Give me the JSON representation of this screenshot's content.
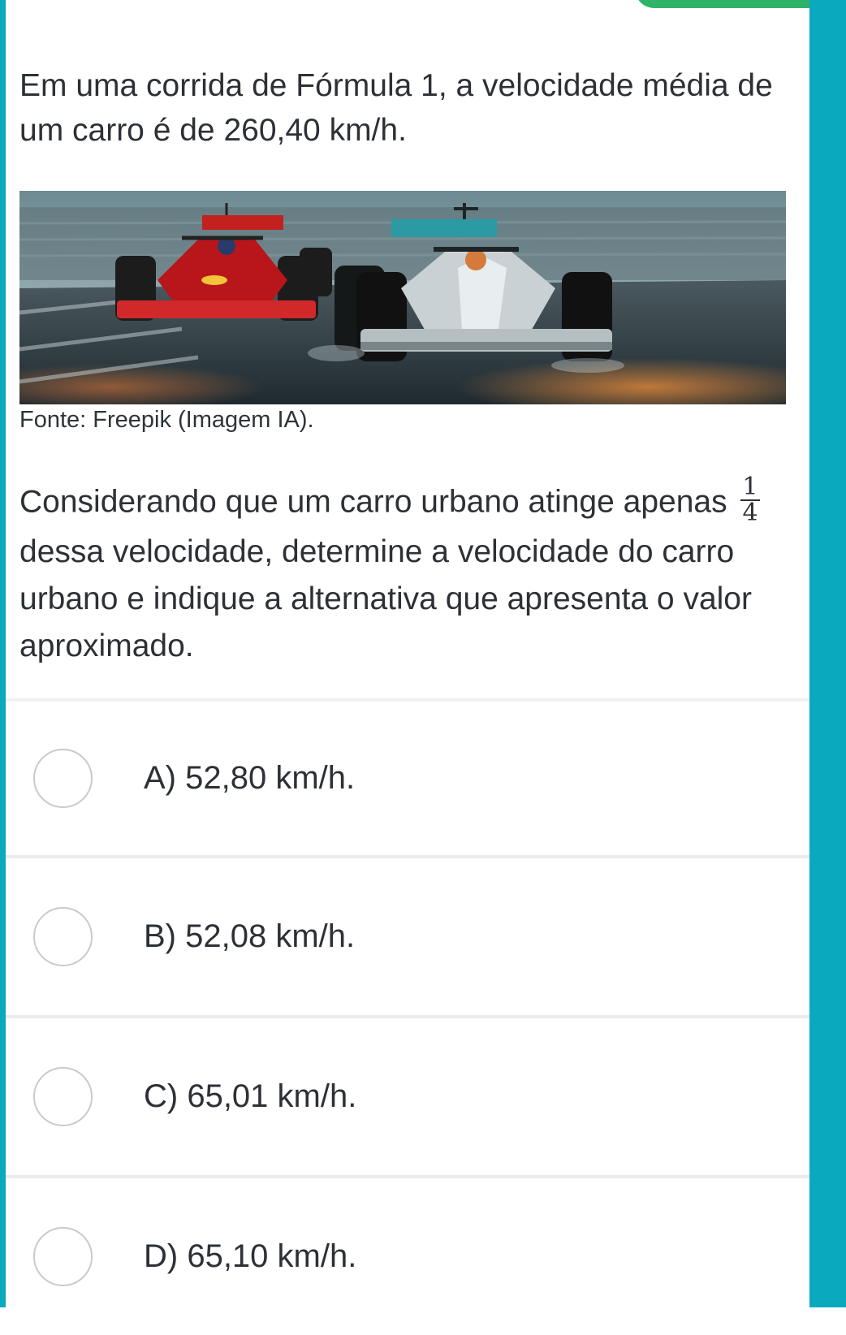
{
  "question": {
    "intro": "Em uma corrida de Fórmula 1, a velocidade média de um carro é de 260,40 km/h.",
    "image_caption": "Fonte: Freepik (Imagem IA).",
    "body_before_fraction": "Considerando que um carro urbano atinge apenas",
    "fraction_numerator": "1",
    "fraction_denominator": "4",
    "body_after_fraction": "dessa velocidade, determine a velocidade do carro urbano e indique a alternativa que apresenta o valor aproximado."
  },
  "options": [
    {
      "label": "A) 52,80 km/h.",
      "selected": false
    },
    {
      "label": "B) 52,08 km/h.",
      "selected": false
    },
    {
      "label": "C) 65,01 km/h.",
      "selected": false
    },
    {
      "label": "D) 65,10 km/h.",
      "selected": false
    }
  ],
  "colors": {
    "frame": "#0aa9bd",
    "progress": "#2fb36a",
    "text": "#2d3136",
    "radio_border": "#c8cacc"
  }
}
